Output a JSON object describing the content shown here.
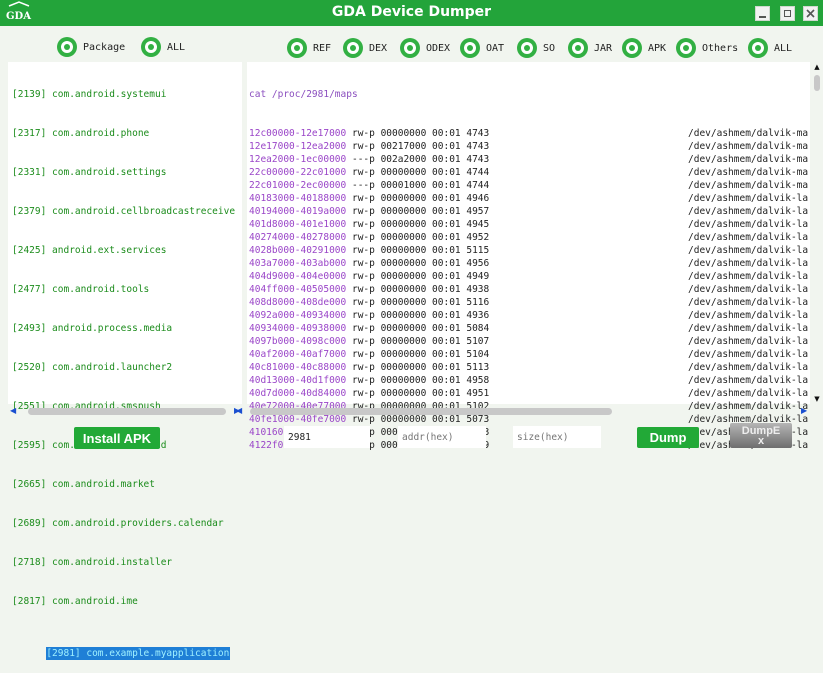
{
  "window": {
    "title": "GDA Device Dumper",
    "logo_text": "GDA"
  },
  "left_filter": [
    {
      "label": "Package",
      "checked": true
    },
    {
      "label": "ALL",
      "checked": true
    }
  ],
  "right_filter": [
    {
      "label": "REF",
      "checked": true
    },
    {
      "label": "DEX",
      "checked": true
    },
    {
      "label": "ODEX",
      "checked": true
    },
    {
      "label": "OAT",
      "checked": true
    },
    {
      "label": "SO",
      "checked": true
    },
    {
      "label": "JAR",
      "checked": true
    },
    {
      "label": "APK",
      "checked": true
    },
    {
      "label": "Others",
      "checked": true
    },
    {
      "label": "ALL",
      "checked": true
    }
  ],
  "processes": [
    "[2139] com.android.systemui",
    "[2317] com.android.phone",
    "[2331] com.android.settings",
    "[2379] com.android.cellbroadcastreceive",
    "[2425] android.ext.services",
    "[2477] com.android.tools",
    "[2493] android.process.media",
    "[2520] com.android.launcher2",
    "[2551] com.android.smspush",
    "[2595] com.android.download",
    "[2665] com.android.market",
    "[2689] com.android.providers.calendar",
    "[2718] com.android.installer",
    "[2817] com.android.ime",
    "[2981] com.example.myapplication"
  ],
  "selected_process_index": 14,
  "maps_command": "cat /proc/2981/maps",
  "maps": [
    {
      "range": "12c00000-12e17000",
      "info": "rw-p 00000000 00:01 4743",
      "path": "/dev/ashmem/dalvik-ma"
    },
    {
      "range": "12e17000-12ea2000",
      "info": "rw-p 00217000 00:01 4743",
      "path": "/dev/ashmem/dalvik-ma"
    },
    {
      "range": "12ea2000-1ec00000",
      "info": "---p 002a2000 00:01 4743",
      "path": "/dev/ashmem/dalvik-ma"
    },
    {
      "range": "22c00000-22c01000",
      "info": "rw-p 00000000 00:01 4744",
      "path": "/dev/ashmem/dalvik-ma"
    },
    {
      "range": "22c01000-2ec00000",
      "info": "---p 00001000 00:01 4744",
      "path": "/dev/ashmem/dalvik-ma"
    },
    {
      "range": "40183000-40188000",
      "info": "rw-p 00000000 00:01 4946",
      "path": "/dev/ashmem/dalvik-la"
    },
    {
      "range": "40194000-4019a000",
      "info": "rw-p 00000000 00:01 4957",
      "path": "/dev/ashmem/dalvik-la"
    },
    {
      "range": "401d8000-401e1000",
      "info": "rw-p 00000000 00:01 4945",
      "path": "/dev/ashmem/dalvik-la"
    },
    {
      "range": "40274000-40278000",
      "info": "rw-p 00000000 00:01 4952",
      "path": "/dev/ashmem/dalvik-la"
    },
    {
      "range": "4028b000-40291000",
      "info": "rw-p 00000000 00:01 5115",
      "path": "/dev/ashmem/dalvik-la"
    },
    {
      "range": "403a7000-403ab000",
      "info": "rw-p 00000000 00:01 4956",
      "path": "/dev/ashmem/dalvik-la"
    },
    {
      "range": "404d9000-404e0000",
      "info": "rw-p 00000000 00:01 4949",
      "path": "/dev/ashmem/dalvik-la"
    },
    {
      "range": "404ff000-40505000",
      "info": "rw-p 00000000 00:01 4938",
      "path": "/dev/ashmem/dalvik-la"
    },
    {
      "range": "408d8000-408de000",
      "info": "rw-p 00000000 00:01 5116",
      "path": "/dev/ashmem/dalvik-la"
    },
    {
      "range": "4092a000-40934000",
      "info": "rw-p 00000000 00:01 4936",
      "path": "/dev/ashmem/dalvik-la"
    },
    {
      "range": "40934000-40938000",
      "info": "rw-p 00000000 00:01 5084",
      "path": "/dev/ashmem/dalvik-la"
    },
    {
      "range": "4097b000-4098c000",
      "info": "rw-p 00000000 00:01 5107",
      "path": "/dev/ashmem/dalvik-la"
    },
    {
      "range": "40af2000-40af7000",
      "info": "rw-p 00000000 00:01 5104",
      "path": "/dev/ashmem/dalvik-la"
    },
    {
      "range": "40c81000-40c88000",
      "info": "rw-p 00000000 00:01 5113",
      "path": "/dev/ashmem/dalvik-la"
    },
    {
      "range": "40d13000-40d1f000",
      "info": "rw-p 00000000 00:01 4958",
      "path": "/dev/ashmem/dalvik-la"
    },
    {
      "range": "40d7d000-40d84000",
      "info": "rw-p 00000000 00:01 4951",
      "path": "/dev/ashmem/dalvik-la"
    },
    {
      "range": "40e72000-40e77000",
      "info": "rw-p 00000000 00:01 5102",
      "path": "/dev/ashmem/dalvik-la"
    },
    {
      "range": "40fe1000-40fe7000",
      "info": "rw-p 00000000 00:01 5073",
      "path": "/dev/ashmem/dalvik-la"
    },
    {
      "range": "41016000-41027000",
      "info": "rw-p 00000000 00:01 5108",
      "path": "/dev/ashmem/dalvik-la"
    },
    {
      "range": "4122f000-41234000",
      "info": "rw-p 00000000 00:01 5109",
      "path": "/dev/ashmem/dalvik-la"
    }
  ],
  "controls": {
    "install_label": "Install APK",
    "pid_value": "2981",
    "addr_placeholder": "addr(hex)",
    "size_placeholder": "size(hex)",
    "dump_label": "Dump",
    "dumpex_label_line1": "DumpE",
    "dumpex_label_line2": "x"
  },
  "colors": {
    "titlebar": "#23a43a",
    "accent": "#32b043",
    "selection": "#1f7fd6"
  },
  "icons": [
    "minimize-icon",
    "maximize-icon",
    "close-icon",
    "scroll-left-icon",
    "scroll-right-icon",
    "scroll-up-icon",
    "scroll-down-icon"
  ]
}
